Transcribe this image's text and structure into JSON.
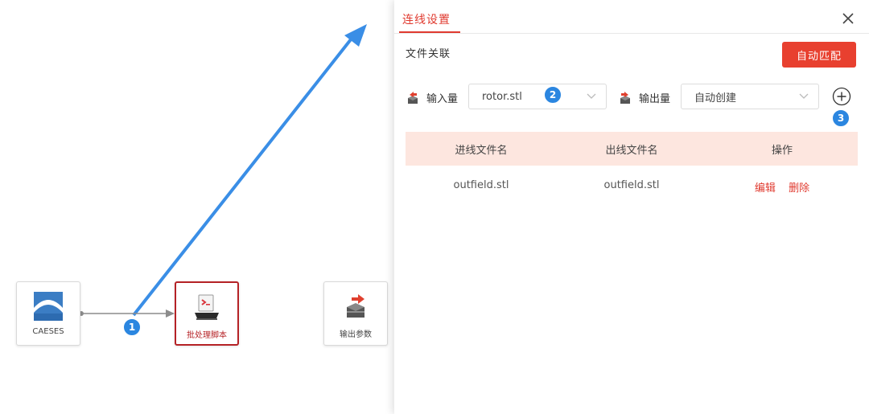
{
  "canvas": {
    "nodes": [
      {
        "label": "CAESES"
      },
      {
        "label": "批处理脚本"
      },
      {
        "label": "输出参数"
      }
    ],
    "badges": [
      "1",
      "2",
      "3"
    ]
  },
  "dialog": {
    "tab_label": "连线设置",
    "section_title": "文件关联",
    "auto_match_label": "自动匹配",
    "input": {
      "label": "输入量",
      "value": "rotor.stl"
    },
    "output": {
      "label": "输出量",
      "value": "自动创建"
    },
    "table": {
      "headers": [
        "进线文件名",
        "出线文件名",
        "操作"
      ],
      "rows": [
        {
          "in_file": "outfield.stl",
          "out_file": "outfield.stl",
          "edit": "编辑",
          "delete": "删除"
        }
      ]
    }
  },
  "colors": {
    "accent": "#e03a2f",
    "badge": "#2b86e0",
    "selected_border": "#b52226",
    "table_header_bg": "#fde6df",
    "arrow": "#3a8ee6"
  }
}
